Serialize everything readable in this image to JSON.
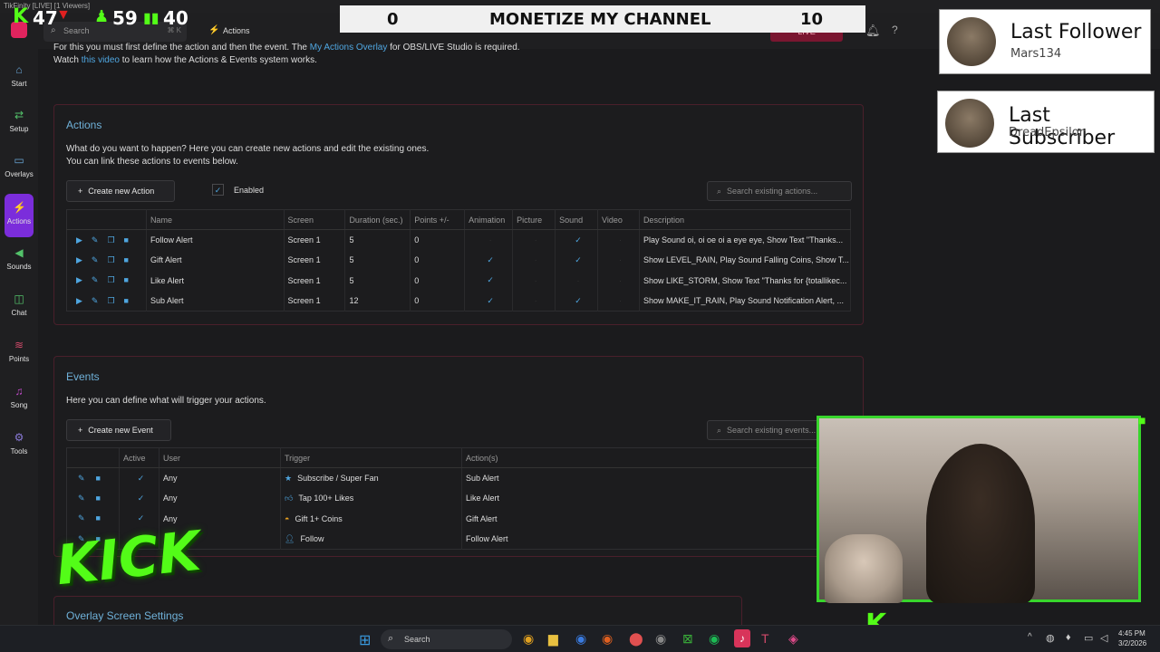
{
  "window": {
    "title": "TikFinity [LIVE] [1 Viewers]"
  },
  "stats": {
    "kick_count": "47",
    "green_count": "59",
    "bars_count": "40"
  },
  "topbar": {
    "search_placeholder": "Search",
    "search_shortcut": "⌘ K",
    "section_label": "Actions",
    "live_label": "LIVE"
  },
  "goal_overlay": {
    "left_value": "0",
    "title": "MONETIZE MY CHANNEL",
    "right_value": "10"
  },
  "alerts": {
    "follower": {
      "title": "Last Follower",
      "name": "Mars134"
    },
    "subscriber": {
      "title": "Last Subscriber",
      "name": "DreadEpsilon"
    }
  },
  "sidebar": {
    "items": [
      {
        "label": "Start",
        "icon": "home-icon"
      },
      {
        "label": "Setup",
        "icon": "sliders-icon"
      },
      {
        "label": "Overlays",
        "icon": "monitor-icon"
      },
      {
        "label": "Actions",
        "icon": "bolt-icon"
      },
      {
        "label": "Sounds",
        "icon": "speaker-icon"
      },
      {
        "label": "Chat",
        "icon": "chat-icon"
      },
      {
        "label": "Points",
        "icon": "points-icon"
      },
      {
        "label": "Song",
        "icon": "music-icon"
      },
      {
        "label": "Tools",
        "icon": "tools-icon"
      }
    ]
  },
  "intro": {
    "line1_a": "For this you must first define the action and then the event. The ",
    "line1_link": "My Actions Overlay",
    "line1_b": " for OBS/LIVE Studio is required.",
    "line2_a": "Watch ",
    "line2_link": "this video",
    "line2_b": " to learn how the Actions & Events system works."
  },
  "actions": {
    "title": "Actions",
    "desc1": "What do you want to happen? Here you can create new actions and edit the existing ones.",
    "desc2": "You can link these actions to events below.",
    "create_label": "Create new Action",
    "enabled_label": "Enabled",
    "search_placeholder": "Search existing actions...",
    "columns": [
      "Name",
      "Screen",
      "Duration (sec.)",
      "Points +/-",
      "Animation",
      "Picture",
      "Sound",
      "Video",
      "Description"
    ],
    "rows": [
      {
        "name": "Follow Alert",
        "screen": "Screen 1",
        "duration": "5",
        "points": "0",
        "animation": false,
        "picture": false,
        "sound": true,
        "video": false,
        "description": "Play Sound oi, oi oe oi a eye eye, Show Text \"Thanks..."
      },
      {
        "name": "Gift Alert",
        "screen": "Screen 1",
        "duration": "5",
        "points": "0",
        "animation": true,
        "picture": false,
        "sound": true,
        "video": false,
        "description": "Show LEVEL_RAIN, Play Sound Falling Coins, Show T..."
      },
      {
        "name": "Like Alert",
        "screen": "Screen 1",
        "duration": "5",
        "points": "0",
        "animation": true,
        "picture": false,
        "sound": false,
        "video": false,
        "description": "Show LIKE_STORM, Show Text \"Thanks for {totallikec..."
      },
      {
        "name": "Sub Alert",
        "screen": "Screen 1",
        "duration": "12",
        "points": "0",
        "animation": true,
        "picture": false,
        "sound": true,
        "video": false,
        "description": "Show MAKE_IT_RAIN, Play Sound Notification Alert, ..."
      }
    ]
  },
  "events": {
    "title": "Events",
    "desc": "Here you can define what will trigger your actions.",
    "create_label": "Create new Event",
    "search_placeholder": "Search existing events...",
    "columns": [
      "Active",
      "User",
      "Trigger",
      "Action(s)"
    ],
    "rows": [
      {
        "active": true,
        "user": "Any",
        "trigger": "Subscribe / Super Fan",
        "trigger_icon": "star-icon",
        "action": "Sub Alert"
      },
      {
        "active": true,
        "user": "Any",
        "trigger": "Tap 100+ Likes",
        "trigger_icon": "thumbs-up-icon",
        "action": "Like Alert"
      },
      {
        "active": true,
        "user": "Any",
        "trigger": "Gift 1+ Coins",
        "trigger_icon": "coins-icon",
        "action": "Gift Alert"
      },
      {
        "active": true,
        "user": "",
        "trigger": "Follow",
        "trigger_icon": "user-plus-icon",
        "action": "Follow Alert"
      }
    ]
  },
  "overlay_settings": {
    "title": "Overlay Screen Settings"
  },
  "kick_logo": {
    "text": "KICK"
  },
  "taskbar": {
    "search_placeholder": "Search",
    "time": "4:45 PM",
    "date": "3/2/2026"
  },
  "colors": {
    "accent_purple": "#7b2ddb",
    "link_blue": "#4fa6e0",
    "kick_green": "#53fc18",
    "panel_border": "#4a1f2b"
  }
}
